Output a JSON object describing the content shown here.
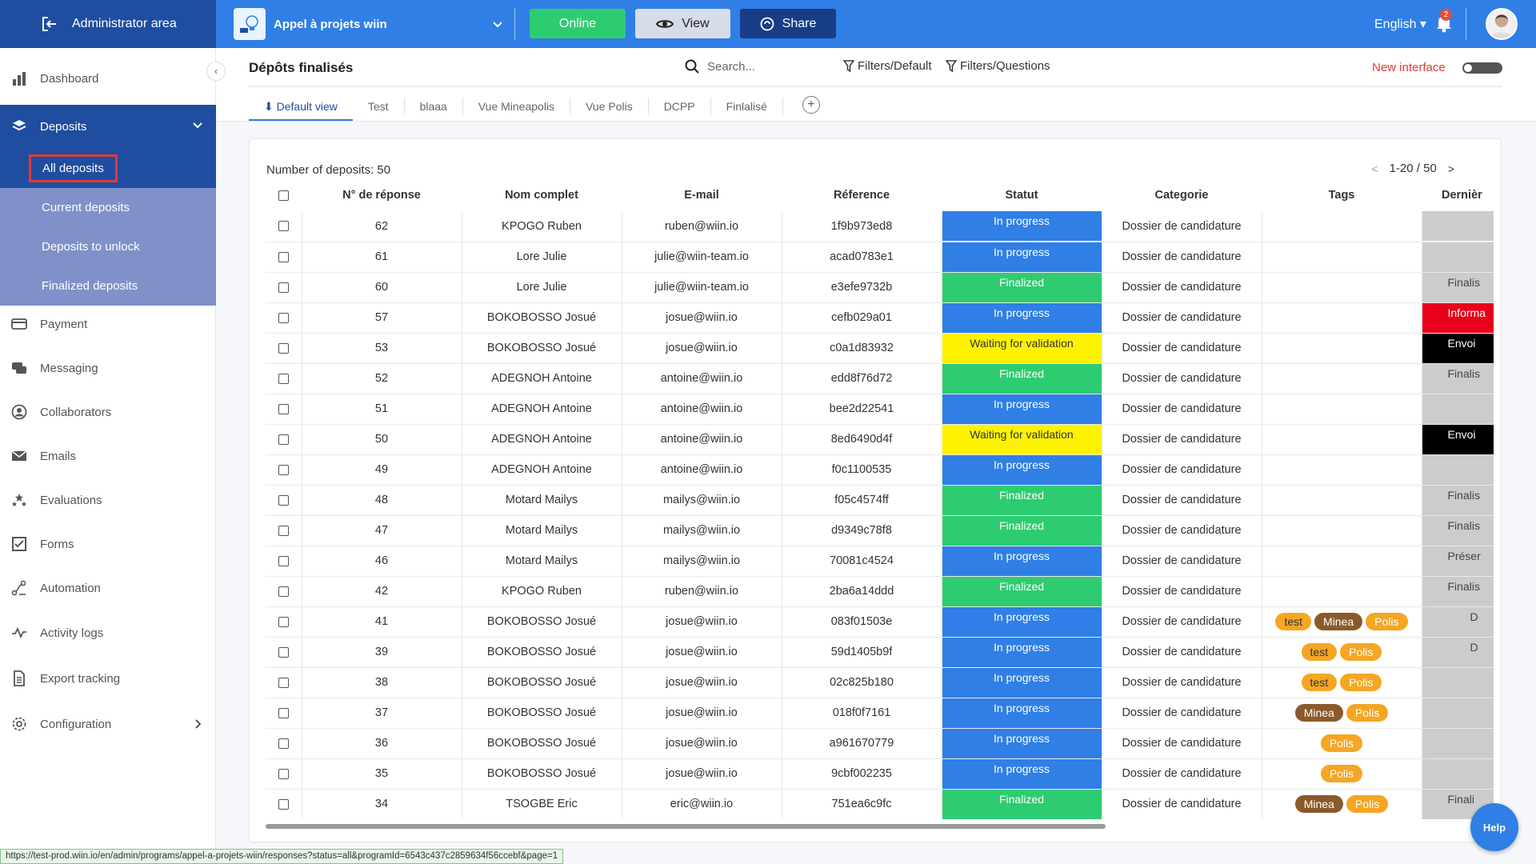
{
  "topbar": {
    "admin_label": "Administrator area",
    "program_name": "Appel à projets wiin",
    "online_label": "Online",
    "view_label": "View",
    "share_label": "Share",
    "language": "English",
    "notification_count": "2"
  },
  "sidebar": {
    "items": [
      {
        "label": "Dashboard",
        "icon": "bar-chart-icon"
      },
      {
        "label": "Deposits",
        "icon": "layers-icon"
      },
      {
        "label": "Payment",
        "icon": "card-icon"
      },
      {
        "label": "Messaging",
        "icon": "chat-icon"
      },
      {
        "label": "Collaborators",
        "icon": "user-circle-icon"
      },
      {
        "label": "Emails",
        "icon": "mail-icon"
      },
      {
        "label": "Evaluations",
        "icon": "stars-icon"
      },
      {
        "label": "Forms",
        "icon": "checkbox-icon"
      },
      {
        "label": "Automation",
        "icon": "automation-icon"
      },
      {
        "label": "Activity logs",
        "icon": "pulse-icon"
      },
      {
        "label": "Export tracking",
        "icon": "document-icon"
      },
      {
        "label": "Configuration",
        "icon": "gear-icon"
      }
    ],
    "deposit_subitems": [
      "All deposits",
      "Current deposits",
      "Deposits to unlock",
      "Finalized deposits"
    ]
  },
  "header": {
    "title": "Dépôts finalisés",
    "search_placeholder": "Search...",
    "filter_default": "Filters/Default",
    "filter_questions": "Filters/Questions",
    "new_interface": "New interface"
  },
  "tabs": [
    "Default view",
    "Test",
    "blaaa",
    "Vue Mineapolis",
    "Vue Polis",
    "DCPP",
    "Finlalisé"
  ],
  "table": {
    "count_label": "Number of deposits: 50",
    "pagination": "1-20 / 50",
    "columns": [
      "N° de réponse",
      "Nom complet",
      "E-mail",
      "Réference",
      "Statut",
      "Categorie",
      "Tags",
      "Dernièr"
    ],
    "rows": [
      {
        "n": "62",
        "name": "KPOGO Ruben",
        "email": "ruben@wiin.io",
        "ref": "1f9b973ed8",
        "status": "In progress",
        "cat": "Dossier de candidature",
        "tags": [],
        "last": ""
      },
      {
        "n": "61",
        "name": "Lore Julie",
        "email": "julie@wiin-team.io",
        "ref": "acad0783e1",
        "status": "In progress",
        "cat": "Dossier de candidature",
        "tags": [],
        "last": ""
      },
      {
        "n": "60",
        "name": "Lore Julie",
        "email": "julie@wiin-team.io",
        "ref": "e3efe9732b",
        "status": "Finalized",
        "cat": "Dossier de candidature",
        "tags": [],
        "last": "Finalis"
      },
      {
        "n": "57",
        "name": "BOKOBOSSO Josué",
        "email": "josue@wiin.io",
        "ref": "cefb029a01",
        "status": "In progress",
        "cat": "Dossier de candidature",
        "tags": [],
        "last": "Informa"
      },
      {
        "n": "53",
        "name": "BOKOBOSSO Josué",
        "email": "josue@wiin.io",
        "ref": "c0a1d83932",
        "status": "Waiting for validation",
        "cat": "Dossier de candidature",
        "tags": [],
        "last": "Envoi"
      },
      {
        "n": "52",
        "name": "ADEGNOH Antoine",
        "email": "antoine@wiin.io",
        "ref": "edd8f76d72",
        "status": "Finalized",
        "cat": "Dossier de candidature",
        "tags": [],
        "last": "Finalis"
      },
      {
        "n": "51",
        "name": "ADEGNOH Antoine",
        "email": "antoine@wiin.io",
        "ref": "bee2d22541",
        "status": "In progress",
        "cat": "Dossier de candidature",
        "tags": [],
        "last": ""
      },
      {
        "n": "50",
        "name": "ADEGNOH Antoine",
        "email": "antoine@wiin.io",
        "ref": "8ed6490d4f",
        "status": "Waiting for validation",
        "cat": "Dossier de candidature",
        "tags": [],
        "last": "Envoi"
      },
      {
        "n": "49",
        "name": "ADEGNOH Antoine",
        "email": "antoine@wiin.io",
        "ref": "f0c1100535",
        "status": "In progress",
        "cat": "Dossier de candidature",
        "tags": [],
        "last": ""
      },
      {
        "n": "48",
        "name": "Motard Mailys",
        "email": "mailys@wiin.io",
        "ref": "f05c4574ff",
        "status": "Finalized",
        "cat": "Dossier de candidature",
        "tags": [],
        "last": "Finalis"
      },
      {
        "n": "47",
        "name": "Motard Mailys",
        "email": "mailys@wiin.io",
        "ref": "d9349c78f8",
        "status": "Finalized",
        "cat": "Dossier de candidature",
        "tags": [],
        "last": "Finalis"
      },
      {
        "n": "46",
        "name": "Motard Mailys",
        "email": "mailys@wiin.io",
        "ref": "70081c4524",
        "status": "In progress",
        "cat": "Dossier de candidature",
        "tags": [],
        "last": "Préser"
      },
      {
        "n": "42",
        "name": "KPOGO Ruben",
        "email": "ruben@wiin.io",
        "ref": "2ba6a14ddd",
        "status": "Finalized",
        "cat": "Dossier de candidature",
        "tags": [],
        "last": "Finalis"
      },
      {
        "n": "41",
        "name": "BOKOBOSSO Josué",
        "email": "josue@wiin.io",
        "ref": "083f01503e",
        "status": "In progress",
        "cat": "Dossier de candidature",
        "tags": [
          "test",
          "Minea",
          "Polis"
        ],
        "last": "D"
      },
      {
        "n": "39",
        "name": "BOKOBOSSO Josué",
        "email": "josue@wiin.io",
        "ref": "59d1405b9f",
        "status": "In progress",
        "cat": "Dossier de candidature",
        "tags": [
          "test",
          "Polis"
        ],
        "last": "D"
      },
      {
        "n": "38",
        "name": "BOKOBOSSO Josué",
        "email": "josue@wiin.io",
        "ref": "02c825b180",
        "status": "In progress",
        "cat": "Dossier de candidature",
        "tags": [
          "test",
          "Polis"
        ],
        "last": ""
      },
      {
        "n": "37",
        "name": "BOKOBOSSO Josué",
        "email": "josue@wiin.io",
        "ref": "018f0f7161",
        "status": "In progress",
        "cat": "Dossier de candidature",
        "tags": [
          "Minea",
          "Polis"
        ],
        "last": ""
      },
      {
        "n": "36",
        "name": "BOKOBOSSO Josué",
        "email": "josue@wiin.io",
        "ref": "a961670779",
        "status": "In progress",
        "cat": "Dossier de candidature",
        "tags": [
          "Polis"
        ],
        "last": ""
      },
      {
        "n": "35",
        "name": "BOKOBOSSO Josué",
        "email": "josue@wiin.io",
        "ref": "9cbf002235",
        "status": "In progress",
        "cat": "Dossier de candidature",
        "tags": [
          "Polis"
        ],
        "last": ""
      },
      {
        "n": "34",
        "name": "TSOGBE Eric",
        "email": "eric@wiin.io",
        "ref": "751ea6c9fc",
        "status": "Finalized",
        "cat": "Dossier de candidature",
        "tags": [
          "Minea",
          "Polis"
        ],
        "last": "Finali"
      }
    ]
  },
  "status_url": "https://test-prod.wiin.io/en/admin/programs/appel-a-projets-wiin/responses?status=all&programId=6543c437c2859634f56ccebf&page=1",
  "help_label": "Help",
  "colors": {
    "primary": "#2f7fe6",
    "dark_blue": "#1f4da0",
    "success": "#2ecc71",
    "warning": "#fff200",
    "danger": "#e8001c"
  }
}
